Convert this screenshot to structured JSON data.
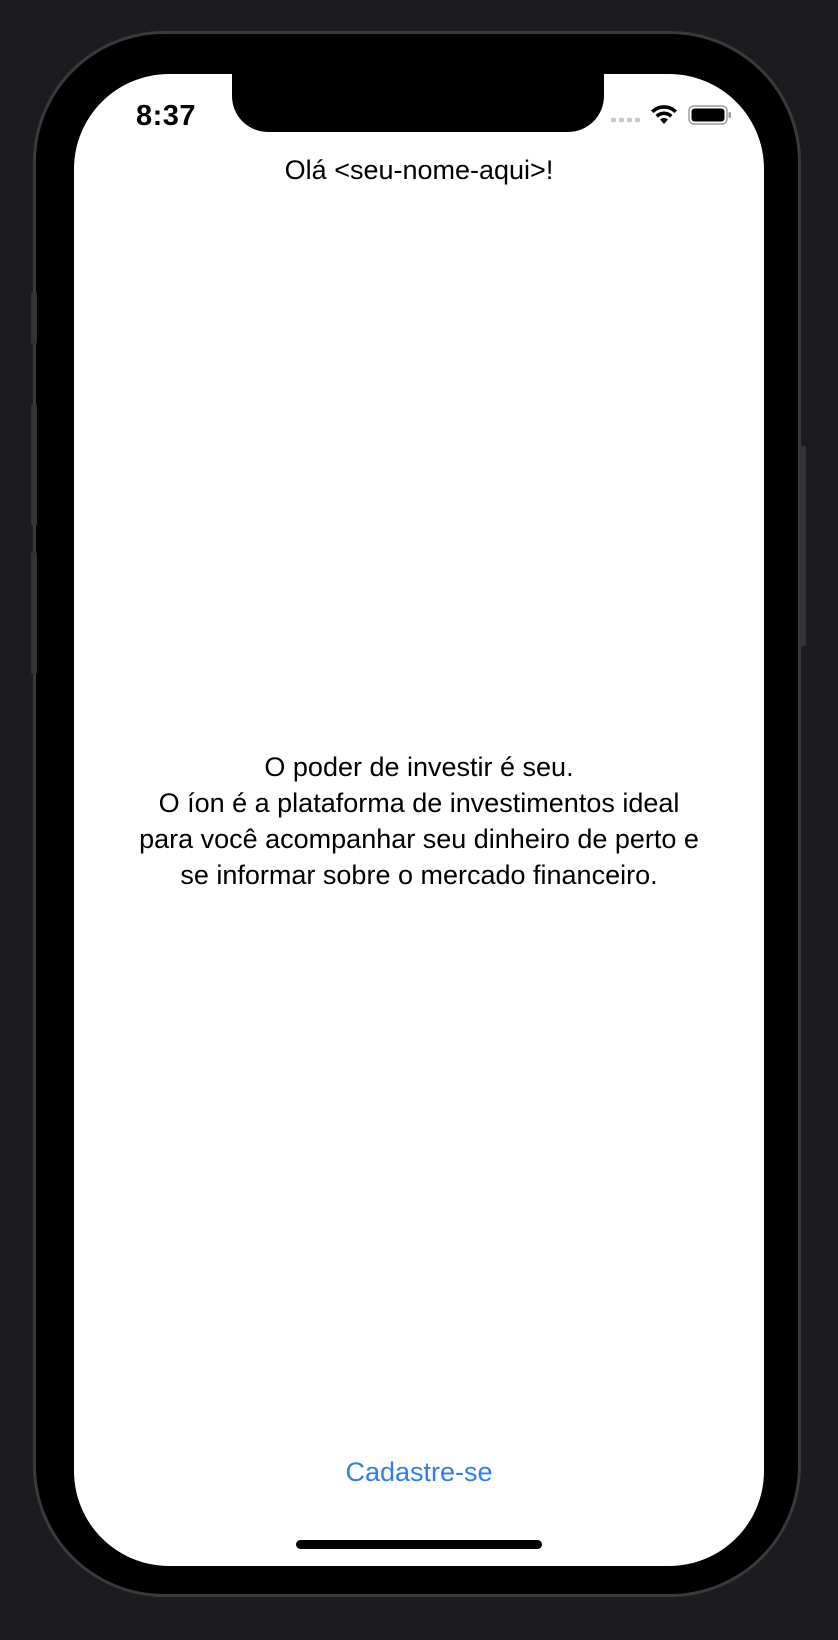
{
  "status_bar": {
    "time": "8:37",
    "icons": [
      "signal-icon",
      "wifi-icon",
      "battery-icon"
    ]
  },
  "greeting": "Olá <seu-nome-aqui>!",
  "intro": {
    "lines": [
      "O poder de investir é seu.",
      "O íon é a plataforma de investimentos ideal",
      "para você acompanhar seu dinheiro de perto e",
      "se informar sobre o mercado financeiro."
    ]
  },
  "signup": {
    "label": "Cadastre-se"
  },
  "colors": {
    "link": "#2f80ed",
    "background": "#ffffff",
    "frame": "#1c1c20"
  }
}
